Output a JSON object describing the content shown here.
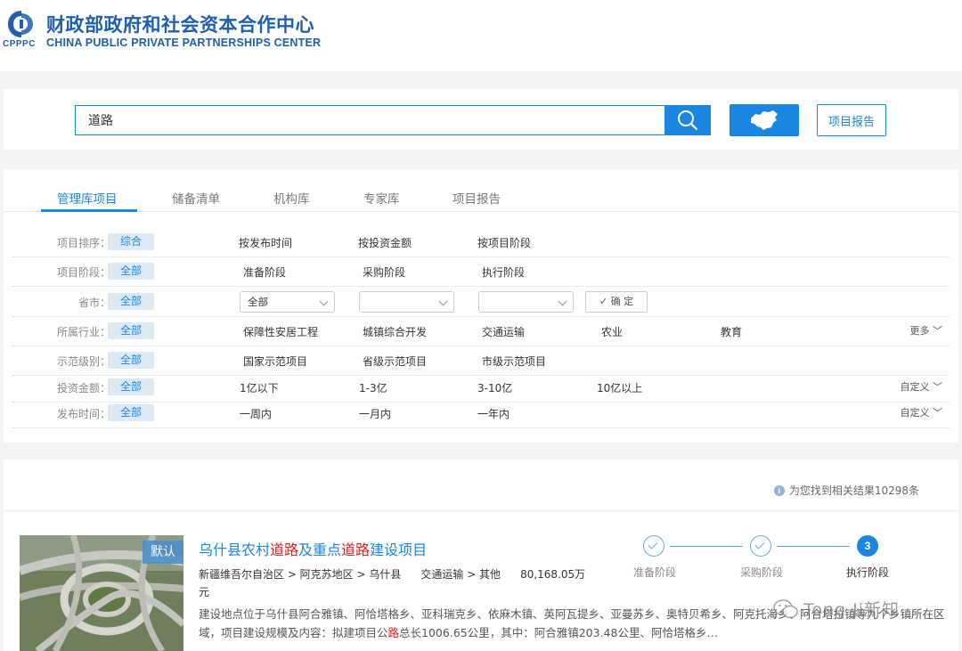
{
  "header": {
    "logo_abbr": "CPPPC",
    "name_cn": "财政部政府和社会资本合作中心",
    "name_en": "CHINA PUBLIC PRIVATE PARTNERSHIPS CENTER"
  },
  "search": {
    "query": "道路",
    "report_button": "项目报告"
  },
  "tabs": [
    "管理库项目",
    "储备清单",
    "机构库",
    "专家库",
    "项目报告"
  ],
  "filters": {
    "all_label": "全部",
    "sort": {
      "label": "项目排序：",
      "selected": "综合",
      "options": [
        "按发布时间",
        "按投资金额",
        "按项目阶段"
      ]
    },
    "stage": {
      "label": "项目阶段：",
      "options": [
        "准备阶段",
        "采购阶段",
        "执行阶段"
      ]
    },
    "province": {
      "label": "省市：",
      "select1": "全部",
      "select2": "",
      "select3": "",
      "confirm": "确 定"
    },
    "industry": {
      "label": "所属行业：",
      "options": [
        "保障性安居工程",
        "城镇综合开发",
        "交通运输",
        "农业",
        "教育"
      ],
      "more": "更多"
    },
    "level": {
      "label": "示范级别：",
      "options": [
        "国家示范项目",
        "省级示范项目",
        "市级示范项目"
      ]
    },
    "amount": {
      "label": "投资金额：",
      "options": [
        "1亿以下",
        "1-3亿",
        "3-10亿",
        "10亿以上"
      ],
      "custom": "自定义"
    },
    "time": {
      "label": "发布时间：",
      "options": [
        "一周内",
        "一月内",
        "一年内"
      ],
      "custom": "自定义"
    }
  },
  "results": {
    "count_text": "为您找到相关结果10298条",
    "item": {
      "badge": "默认",
      "title_parts": [
        "乌什县农村",
        "道路",
        "及重点",
        "道路",
        "建设项目"
      ],
      "region": "新疆维吾尔自治区 > 阿克苏地区 > 乌什县",
      "industry": "交通运输 > 其他",
      "amount": "80,168.05万元",
      "desc_before": "建设地点位于乌什县阿合雅镇、阿恰塔格乡、亚科瑞克乡、依麻木镇、英阿瓦提乡、亚曼苏乡、奥特贝希乡、阿克托海乡、阿合塔拉镇等九个乡镇所在区域，项目建设规模及内容：拟建项目公",
      "desc_hl": "路",
      "desc_after": "总长1006.65公里，其中：阿合雅镇203.48公里、阿恰塔格乡…",
      "stages": [
        {
          "label": "准备阶段",
          "state": "done"
        },
        {
          "label": "采购阶段",
          "state": "done"
        },
        {
          "label": "执行阶段",
          "state": "current",
          "number": "3"
        }
      ]
    }
  },
  "watermark": "Tong Ji新知",
  "colors": {
    "primary": "#1b86e0",
    "logo": "#1f5fae",
    "highlight": "#e02020",
    "tag_bg": "#dde9f5"
  }
}
